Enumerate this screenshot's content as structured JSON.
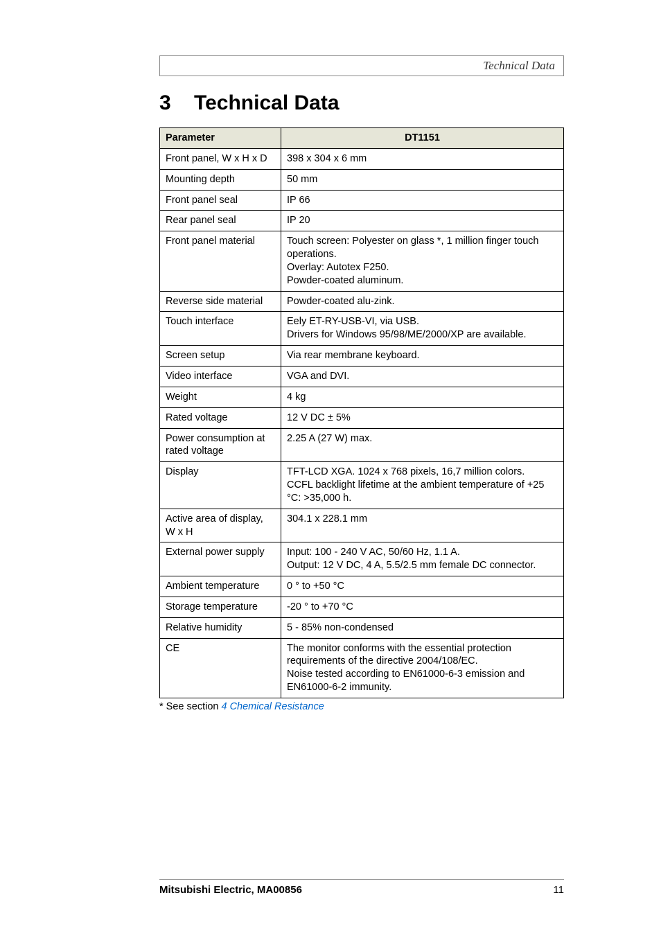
{
  "header_title": "Technical Data",
  "section_number": "3",
  "section_title": "Technical Data",
  "table": {
    "headers": [
      "Parameter",
      "DT1151"
    ],
    "rows": [
      {
        "param": "Front panel, W x H x D",
        "value": "398 x 304 x 6 mm"
      },
      {
        "param": "Mounting depth",
        "value": "50 mm"
      },
      {
        "param": "Front panel seal",
        "value": "IP 66"
      },
      {
        "param": "Rear panel seal",
        "value": "IP 20"
      },
      {
        "param": "Front panel material",
        "value": "Touch screen: Polyester on glass *, 1 million finger touch operations.\nOverlay: Autotex F250.\nPowder-coated aluminum."
      },
      {
        "param": "Reverse side material",
        "value": "Powder-coated alu-zink."
      },
      {
        "param": "Touch interface",
        "value": "Eely ET-RY-USB-VI, via USB.\nDrivers for Windows 95/98/ME/2000/XP are available."
      },
      {
        "param": "Screen setup",
        "value": "Via rear membrane keyboard."
      },
      {
        "param": "Video interface",
        "value": "VGA and DVI."
      },
      {
        "param": "Weight",
        "value": "4 kg"
      },
      {
        "param": "Rated voltage",
        "value": "12 V DC ± 5%"
      },
      {
        "param": "Power consumption at rated voltage",
        "value": "2.25 A (27 W) max."
      },
      {
        "param": "Display",
        "value": "TFT-LCD XGA. 1024 x 768 pixels, 16,7 million colors.\nCCFL backlight lifetime at the ambient temperature of +25 °C: >35,000 h."
      },
      {
        "param": "Active area of display, W x H",
        "value": "304.1 x 228.1 mm"
      },
      {
        "param": "External power supply",
        "value": "Input: 100 - 240 V AC, 50/60 Hz, 1.1 A.\nOutput: 12 V DC, 4 A, 5.5/2.5 mm female DC connector."
      },
      {
        "param": "Ambient temperature",
        "value": "0 ° to +50 °C"
      },
      {
        "param": "Storage temperature",
        "value": "-20 ° to +70 °C"
      },
      {
        "param": "Relative humidity",
        "value": "5 - 85% non-condensed"
      },
      {
        "param": "CE",
        "value": "The monitor conforms with the essential protection requirements of the directive 2004/108/EC.\nNoise tested according to EN61000-6-3 emission and EN61000-6-2 immunity."
      }
    ]
  },
  "footnote_prefix": "* See section  ",
  "footnote_link": "4 Chemical Resistance",
  "footer_left": "Mitsubishi Electric, MA00856",
  "footer_right": "11"
}
